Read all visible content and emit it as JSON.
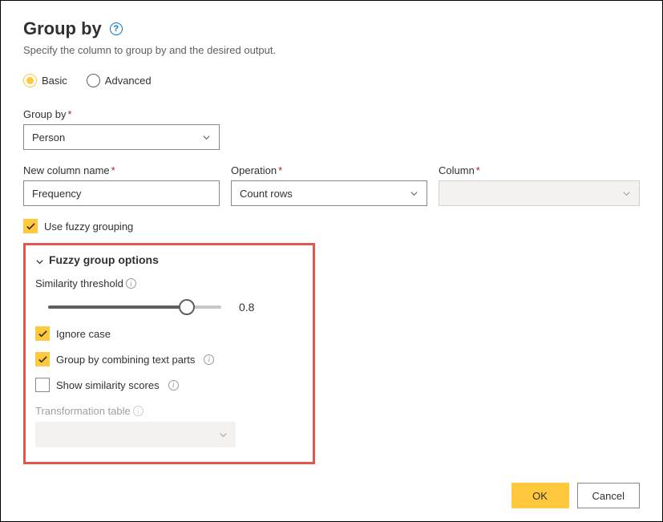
{
  "title": "Group by",
  "subtitle": "Specify the column to group by and the desired output.",
  "mode": {
    "basic": "Basic",
    "advanced": "Advanced",
    "selected": "basic"
  },
  "groupByLabel": "Group by",
  "groupByValue": "Person",
  "newColumnLabel": "New column name",
  "newColumnValue": "Frequency",
  "operationLabel": "Operation",
  "operationValue": "Count rows",
  "columnLabel": "Column",
  "columnValue": "",
  "fuzzyCheckboxLabel": "Use fuzzy grouping",
  "fuzzy": {
    "header": "Fuzzy group options",
    "similarityLabel": "Similarity threshold",
    "similarityValue": "0.8",
    "ignoreCase": "Ignore case",
    "combineTextParts": "Group by combining text parts",
    "showSimilarity": "Show similarity scores",
    "transformationTable": "Transformation table"
  },
  "buttons": {
    "ok": "OK",
    "cancel": "Cancel"
  }
}
